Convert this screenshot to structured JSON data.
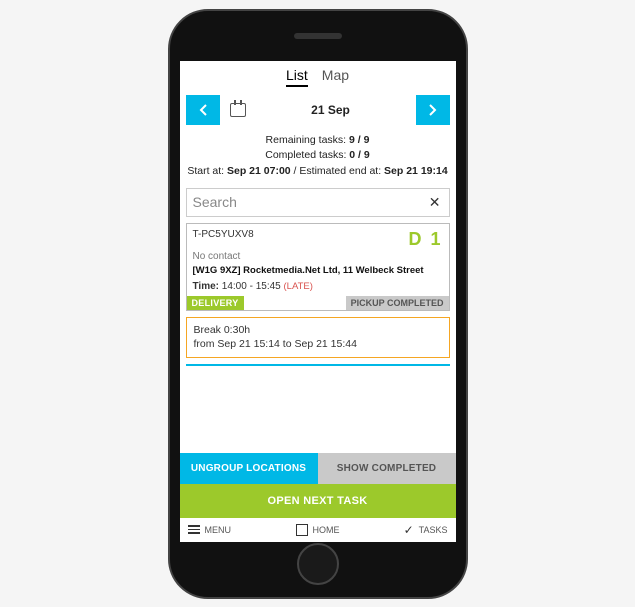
{
  "tabs": {
    "list": "List",
    "map": "Map"
  },
  "datebar": {
    "date": "21 Sep"
  },
  "summary": {
    "remaining_label": "Remaining tasks:",
    "remaining_value": "9 / 9",
    "completed_label": "Completed tasks:",
    "completed_value": "0 / 9",
    "start_label": "Start at:",
    "start_value": "Sep 21 07:00",
    "sep": " / ",
    "end_label": "Estimated end at:",
    "end_value": "Sep 21 19:14"
  },
  "search": {
    "placeholder": "Search"
  },
  "task": {
    "code": "T-PC5YUXV8",
    "badge": "D 1",
    "no_contact": "No contact",
    "address": "[W1G 9XZ] Rocketmedia.Net Ltd, 11 Welbeck Street",
    "time_label": "Time:",
    "time_value": "14:00 - 15:45",
    "late": "(LATE)",
    "delivery_badge": "DELIVERY",
    "pickup_badge": "PICKUP COMPLETED"
  },
  "break": {
    "line1": "Break 0:30h",
    "line2": "from Sep 21 15:14 to Sep 21 15:44"
  },
  "actions": {
    "ungroup": "UNGROUP LOCATIONS",
    "show_completed": "SHOW COMPLETED",
    "open_next": "OPEN NEXT TASK"
  },
  "bottom": {
    "menu": "MENU",
    "home": "HOME",
    "tasks": "TASKS"
  }
}
